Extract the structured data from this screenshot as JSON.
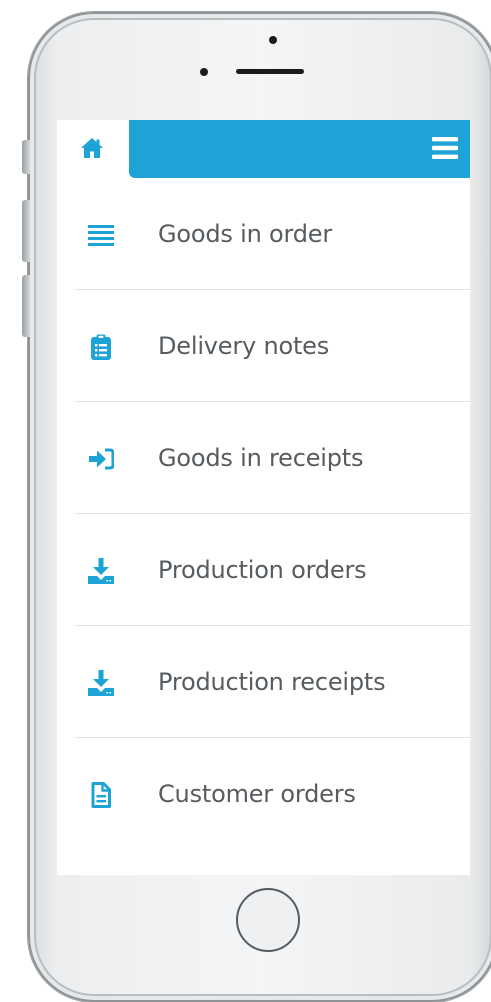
{
  "app": {
    "accent_color": "#1ea3d6",
    "text_color": "#575c60"
  },
  "header": {
    "home_icon": "home-icon",
    "menu_icon": "hamburger-menu-icon"
  },
  "menu": {
    "items": [
      {
        "label": "Goods in order",
        "icon": "list-lines-icon"
      },
      {
        "label": "Delivery notes",
        "icon": "clipboard-list-icon"
      },
      {
        "label": "Goods in receipts",
        "icon": "sign-in-arrow-icon"
      },
      {
        "label": "Production orders",
        "icon": "download-tray-icon"
      },
      {
        "label": "Production receipts",
        "icon": "download-tray-icon"
      },
      {
        "label": "Customer orders",
        "icon": "document-icon"
      }
    ]
  }
}
